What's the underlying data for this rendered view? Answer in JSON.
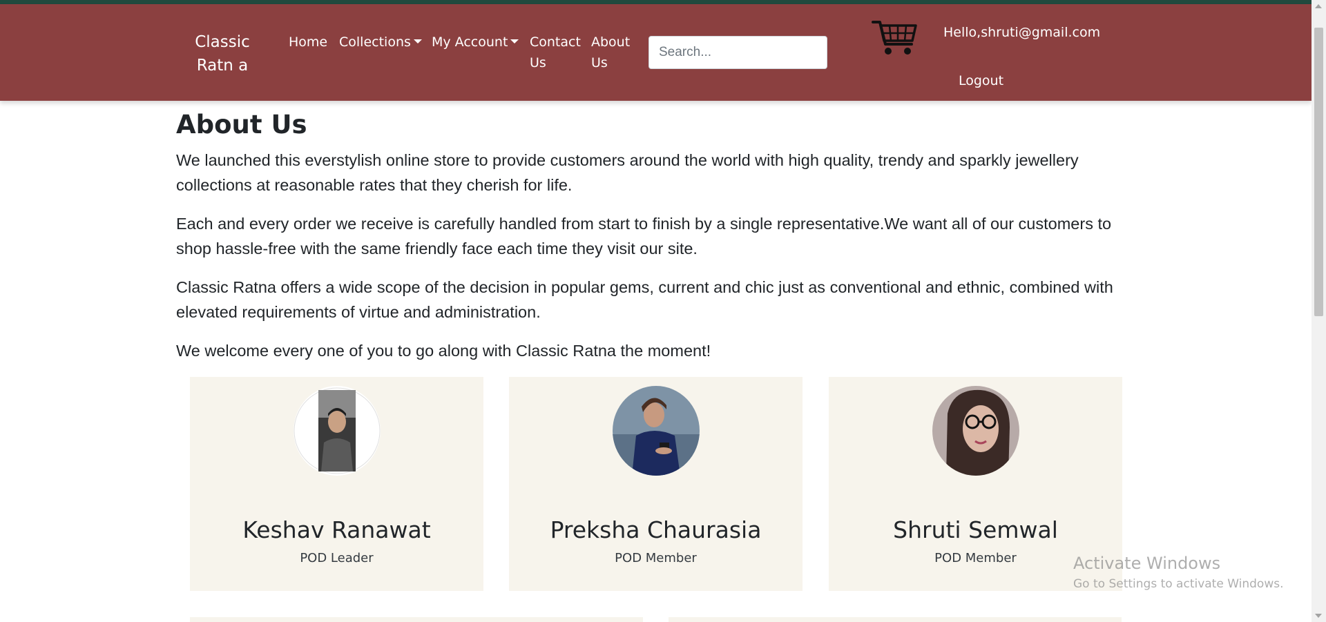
{
  "colors": {
    "navbar": "#8b4040",
    "topline": "#1f4a3e",
    "card_bg": "#f7f4ec",
    "text": "#212529"
  },
  "navbar": {
    "brand": "Classic Ratn a",
    "links": {
      "home": "Home",
      "collections": "Collections",
      "my_account": "My Account",
      "contact_us": "Contact Us",
      "about_us": "About Us"
    },
    "search_placeholder": "Search...",
    "cart_icon": "shopping-cart-icon",
    "greeting": "Hello,shruti@gmail.com",
    "logout": "Logout"
  },
  "main": {
    "heading": "About Us",
    "paragraphs": [
      "We launched this everstylish online store to provide customers around the world with high quality, trendy and sparkly jewellery collections at reasonable rates that they cherish for life.",
      "Each and every order we receive is carefully handled from start to finish by a single representative.We want all of our customers to shop hassle-free with the same friendly face each time they visit our site.",
      "Classic Ratna offers a wide scope of the decision in popular gems, current and chic just as conventional and ethnic, combined with elevated requirements of virtue and administration.",
      "We welcome every one of you to go along with Classic Ratna the moment!"
    ],
    "team": [
      {
        "name": "Keshav Ranawat",
        "role": "POD Leader"
      },
      {
        "name": "Preksha Chaurasia",
        "role": "POD Member"
      },
      {
        "name": "Shruti Semwal",
        "role": "POD Member"
      }
    ]
  },
  "watermark": {
    "title": "Activate Windows",
    "subtitle": "Go to Settings to activate Windows."
  }
}
